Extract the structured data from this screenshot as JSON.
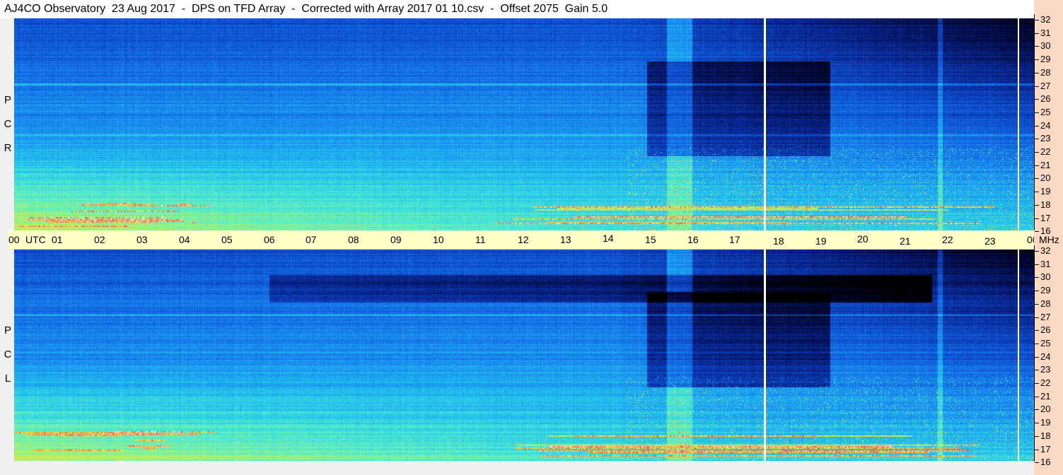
{
  "title": "AJ4CO Observatory  23 Aug 2017  -  DPS on TFD Array  -  Corrected with Array 2017 01 10.csv  -  Offset 2075  Gain 5.0",
  "utc_axis": {
    "labels": [
      "00",
      "UTC",
      "01",
      "02",
      "03",
      "04",
      "05",
      "06",
      "07",
      "08",
      "09",
      "10",
      "11",
      "12",
      "13",
      "14",
      "15",
      "16",
      "17",
      "18",
      "19",
      "20",
      "21",
      "22",
      "23",
      "00"
    ]
  },
  "mhz_axis": {
    "unit": "MHz",
    "ticks": [
      "32",
      "31",
      "30",
      "29",
      "28",
      "27",
      "26",
      "25",
      "24",
      "23",
      "22",
      "21",
      "20",
      "19",
      "18",
      "17",
      "16"
    ]
  },
  "panels": [
    {
      "id": "rcp",
      "label_letters": [
        "P",
        "C",
        "R"
      ]
    },
    {
      "id": "lcp",
      "label_letters": [
        "P",
        "C",
        "L"
      ]
    }
  ],
  "chart_data": {
    "type": "heatmap",
    "title": "AJ4CO Observatory  23 Aug 2017  -  DPS on TFD Array  -  Corrected with Array 2017 01 10.csv  -  Offset 2075  Gain 5.0",
    "x_unit": "UTC",
    "x_range_hours": [
      0,
      24
    ],
    "y_unit": "MHz",
    "y_range_mhz": [
      16,
      32
    ],
    "series": [
      {
        "name": "R C P"
      },
      {
        "name": "L C P"
      }
    ],
    "data_gap_utc": 17.65,
    "end_marker_utc": 23.68,
    "colormap": [
      "#000000",
      "#020a40",
      "#0a2a9a",
      "#0f57d8",
      "#1a8cf0",
      "#22c4ee",
      "#55eecc",
      "#b4f260",
      "#f8e040",
      "#ff4040",
      "#ffffff"
    ]
  }
}
